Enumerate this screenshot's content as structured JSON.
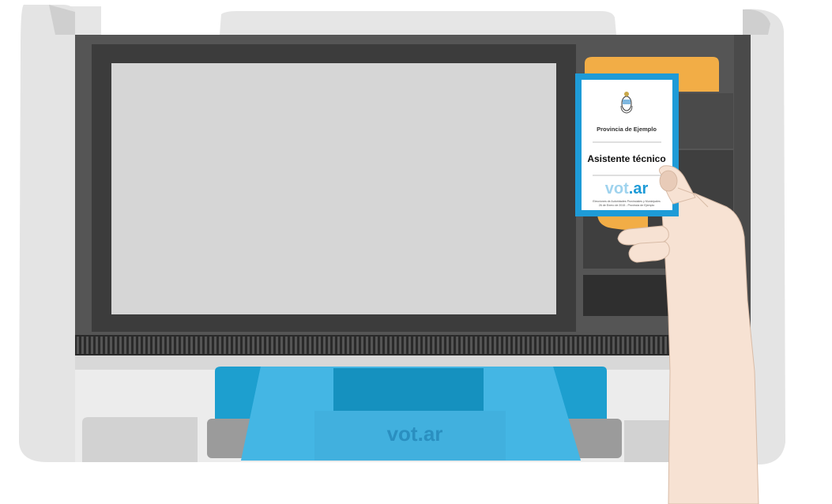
{
  "card": {
    "province": "Provincia de Ejemplo",
    "role": "Asistente técnico",
    "brand_main": "vot",
    "brand_accent": ".ar",
    "footer_line1": "Elecciones de Autoridades Provinciales y Municipales",
    "footer_line2": "26 de Enero de 2015 - Provincia de Ejemplo"
  },
  "tray": {
    "brand": "vot.ar"
  },
  "colors": {
    "housing": "#e8e8e8",
    "frame": "#555555",
    "screen": "#d6d6d6",
    "accent_blue": "#1e9bd7",
    "tray_blue": "#44b6e4",
    "tray_dark": "#1591bf",
    "orange": "#f2ad46",
    "skin": "#f7e2d3"
  },
  "icons": [
    "coat-of-arms-icon"
  ]
}
